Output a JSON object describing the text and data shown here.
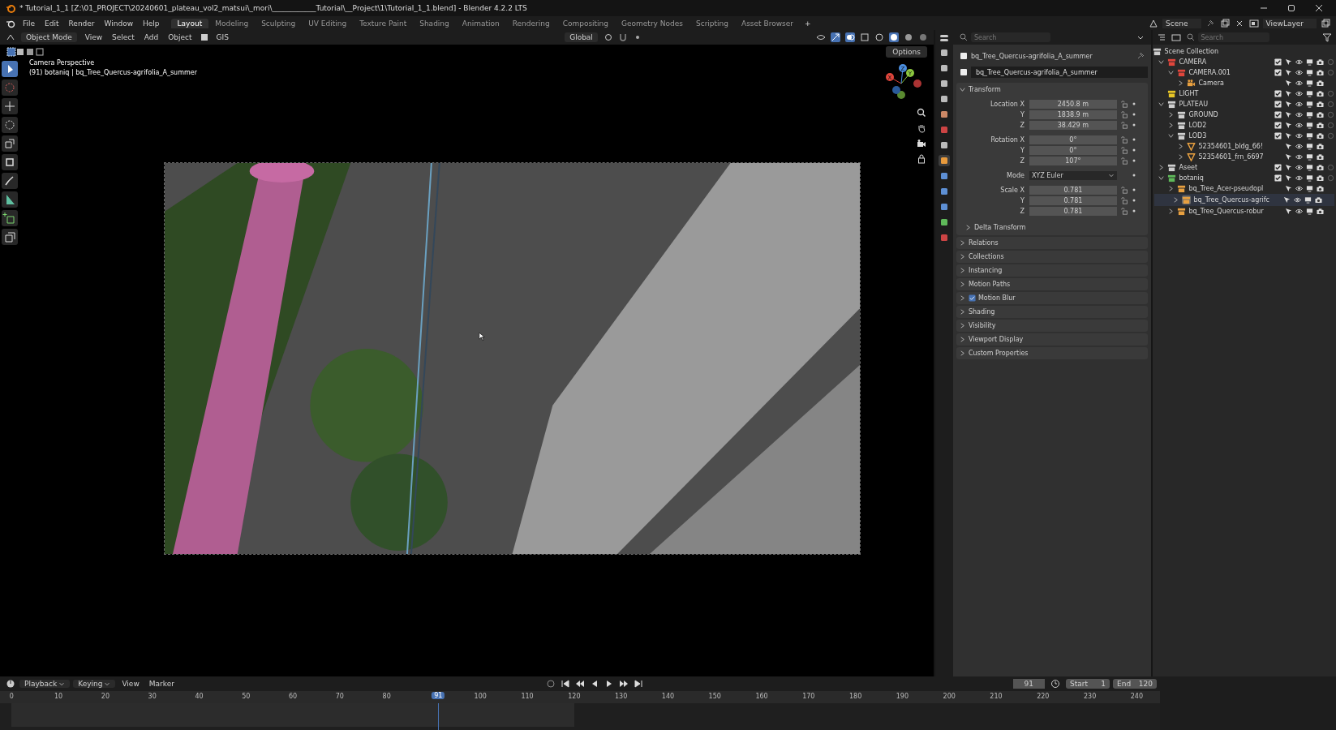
{
  "window": {
    "title": "* Tutorial_1_1 [Z:\\01_PROJECT\\20240601_plateau_vol2_matsui\\_mori\\____________Tutorial\\__Project\\1\\Tutorial_1_1.blend] - Blender 4.2.2 LTS"
  },
  "menu": [
    "File",
    "Edit",
    "Render",
    "Window",
    "Help"
  ],
  "workspaces": [
    {
      "label": "Layout",
      "selected": true
    },
    {
      "label": "Modeling",
      "selected": false
    },
    {
      "label": "Sculpting",
      "selected": false
    },
    {
      "label": "UV Editing",
      "selected": false
    },
    {
      "label": "Texture Paint",
      "selected": false
    },
    {
      "label": "Shading",
      "selected": false
    },
    {
      "label": "Animation",
      "selected": false
    },
    {
      "label": "Rendering",
      "selected": false
    },
    {
      "label": "Compositing",
      "selected": false
    },
    {
      "label": "Geometry Nodes",
      "selected": false
    },
    {
      "label": "Scripting",
      "selected": false
    },
    {
      "label": "Asset Browser",
      "selected": false
    }
  ],
  "add_workspace": "+",
  "scene": {
    "scene": "Scene",
    "view_layer": "ViewLayer"
  },
  "viewport": {
    "mode": "Object Mode",
    "menus": [
      "View",
      "Select",
      "Add",
      "Object"
    ],
    "gis": "GIS",
    "orientation": "Global",
    "options": "Options",
    "overlay": [
      "Camera Perspective",
      "(91) botaniq | bq_Tree_Quercus-agrifolia_A_summer"
    ],
    "gizmo_axes": [
      "X",
      "Y",
      "Z"
    ],
    "tools": [
      {
        "kind": "select",
        "selected": true
      },
      {
        "kind": "cursor",
        "selected": false
      },
      {
        "kind": "move",
        "selected": false
      },
      {
        "kind": "rotate",
        "selected": false
      },
      {
        "kind": "scale",
        "selected": false
      },
      {
        "kind": "transform",
        "selected": false
      },
      {
        "kind": "annotate",
        "selected": false
      },
      {
        "kind": "measure",
        "selected": false
      },
      {
        "kind": "add",
        "selected": false
      },
      {
        "kind": "extrude",
        "selected": false
      }
    ]
  },
  "properties": {
    "search": {
      "placeholder": "Search"
    },
    "tabs": [
      {
        "kind": "tool",
        "selected": false
      },
      {
        "kind": "render",
        "selected": false
      },
      {
        "kind": "output",
        "selected": false
      },
      {
        "kind": "view",
        "selected": false
      },
      {
        "kind": "scene",
        "selected": false
      },
      {
        "kind": "world",
        "selected": false
      },
      {
        "kind": "collection",
        "selected": false
      },
      {
        "kind": "object",
        "selected": true
      },
      {
        "kind": "modifier",
        "selected": false
      },
      {
        "kind": "physics",
        "selected": false
      },
      {
        "kind": "constraint",
        "selected": false
      },
      {
        "kind": "data",
        "selected": false
      },
      {
        "kind": "texture",
        "selected": false
      }
    ],
    "object_name": "bq_Tree_Quercus-agrifolia_A_summer",
    "data_name": "bq_Tree_Quercus-agrifolia_A_summer",
    "transform": {
      "label": "Transform",
      "expanded": true,
      "groups": [
        [
          {
            "label": "Location X",
            "value": "2450.8 m",
            "kind": "number"
          },
          {
            "label": "Y",
            "value": "1838.9 m",
            "kind": "number"
          },
          {
            "label": "Z",
            "value": "38.429 m",
            "kind": "number"
          }
        ],
        [
          {
            "label": "Rotation X",
            "value": "0°",
            "kind": "number"
          },
          {
            "label": "Y",
            "value": "0°",
            "kind": "number"
          },
          {
            "label": "Z",
            "value": "107°",
            "kind": "number"
          }
        ],
        [
          {
            "label": "Mode",
            "value": "XYZ Euler",
            "kind": "dropdown"
          }
        ],
        [
          {
            "label": "Scale X",
            "value": "0.781",
            "kind": "number"
          },
          {
            "label": "Y",
            "value": "0.781",
            "kind": "number"
          },
          {
            "label": "Z",
            "value": "0.781",
            "kind": "number"
          }
        ]
      ],
      "subpanels": [
        {
          "label": "Delta Transform",
          "expanded": false
        }
      ]
    },
    "sections": [
      {
        "label": "Relations",
        "expanded": false,
        "kind": "plain"
      },
      {
        "label": "Collections",
        "expanded": false,
        "kind": "plain"
      },
      {
        "label": "Instancing",
        "expanded": false,
        "kind": "plain"
      },
      {
        "label": "Motion Paths",
        "expanded": false,
        "kind": "plain"
      },
      {
        "label": "Motion Blur",
        "expanded": false,
        "kind": "checkbox",
        "checked": true
      },
      {
        "label": "Shading",
        "expanded": false,
        "kind": "plain"
      },
      {
        "label": "Visibility",
        "expanded": false,
        "kind": "plain"
      },
      {
        "label": "Viewport Display",
        "expanded": false,
        "kind": "plain"
      },
      {
        "label": "Custom Properties",
        "expanded": false,
        "kind": "plain"
      }
    ]
  },
  "outliner": {
    "search": {
      "placeholder": "Search"
    },
    "root": "Scene Collection",
    "items": [
      {
        "name": "CAMERA",
        "kind": "collection",
        "color": "#e0463c",
        "expandable": true,
        "expanded": true,
        "checked": true,
        "selected": false,
        "children": [
          {
            "name": "CAMERA.001",
            "kind": "collection",
            "color": "#e0463c",
            "expandable": true,
            "expanded": true,
            "checked": true,
            "selected": false,
            "children": [
              {
                "name": "Camera",
                "kind": "camera",
                "expandable": true,
                "expanded": false,
                "selected": false
              }
            ]
          }
        ]
      },
      {
        "name": "LIGHT",
        "kind": "collection",
        "color": "#e8c627",
        "expandable": false,
        "expanded": false,
        "checked": true,
        "selected": false
      },
      {
        "name": "PLATEAU",
        "kind": "collection",
        "color": "#cfcfcf",
        "expandable": true,
        "expanded": true,
        "checked": true,
        "selected": false,
        "children": [
          {
            "name": "GROUND",
            "kind": "collection",
            "color": "#cfcfcf",
            "expandable": true,
            "expanded": false,
            "checked": true,
            "selected": false
          },
          {
            "name": "LOD2",
            "kind": "collection",
            "color": "#cfcfcf",
            "expandable": true,
            "expanded": false,
            "checked": true,
            "selected": false
          },
          {
            "name": "LOD3",
            "kind": "collection",
            "color": "#cfcfcf",
            "expandable": true,
            "expanded": true,
            "checked": true,
            "selected": false,
            "children": [
              {
                "name": "52354601_bldg_66!",
                "kind": "mesh",
                "expandable": true,
                "expanded": false,
                "selected": false
              },
              {
                "name": "52354601_frn_6697",
                "kind": "mesh",
                "expandable": true,
                "expanded": false,
                "selected": false
              }
            ]
          }
        ]
      },
      {
        "name": "Aseet",
        "kind": "collection",
        "color": "#cfcfcf",
        "expandable": true,
        "expanded": false,
        "checked": true,
        "selected": false
      },
      {
        "name": "botaniq",
        "kind": "collection",
        "color": "#5fb95a",
        "expandable": true,
        "expanded": true,
        "checked": true,
        "selected": false,
        "children": [
          {
            "name": "bq_Tree_Acer-pseudopl",
            "kind": "instance",
            "expandable": true,
            "expanded": false,
            "selected": false
          },
          {
            "name": "bq_Tree_Quercus-agrifc",
            "kind": "instance",
            "expandable": true,
            "expanded": false,
            "selected": true
          },
          {
            "name": "bq_Tree_Quercus-robur",
            "kind": "instance",
            "expandable": true,
            "expanded": false,
            "selected": false
          }
        ]
      }
    ]
  },
  "timeline": {
    "menus": [
      {
        "label": "Playback",
        "dropdown": true
      },
      {
        "label": "Keying",
        "dropdown": true
      },
      {
        "label": "View",
        "dropdown": false
      },
      {
        "label": "Marker",
        "dropdown": false
      }
    ],
    "current_frame": "91",
    "playhead_frame": "91",
    "start_label": "Start",
    "start": "1",
    "end_label": "End",
    "end": "120",
    "ruler": [
      "0",
      "10",
      "20",
      "30",
      "40",
      "50",
      "60",
      "70",
      "80",
      "100",
      "110",
      "120",
      "130",
      "140",
      "150",
      "160",
      "170",
      "180",
      "190",
      "200",
      "210",
      "220",
      "230",
      "240"
    ]
  }
}
